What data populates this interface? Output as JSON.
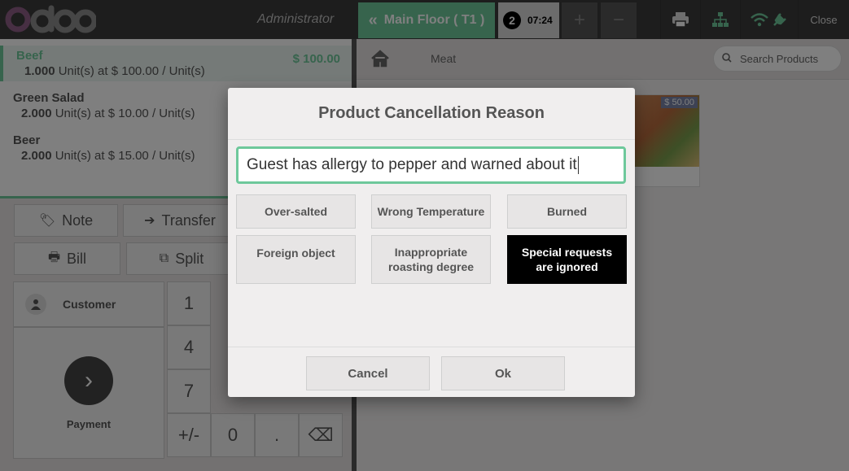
{
  "header": {
    "cashier": "Administrator",
    "floor_button": "Main Floor ( T1 )",
    "order_tab": {
      "guests": "2",
      "time": "07:24"
    },
    "plus_label": "+",
    "minus_label": "−",
    "close_label": "Close"
  },
  "orderlines": [
    {
      "name": "Beef",
      "price": "$ 100.00",
      "qty": "1.000",
      "info": "Unit(s) at $ 100.00 / Unit(s)"
    },
    {
      "name": "Green Salad",
      "price": "",
      "qty": "2.000",
      "info": "Unit(s) at $ 10.00 / Unit(s)"
    },
    {
      "name": "Beer",
      "price": "",
      "qty": "2.000",
      "info": "Unit(s) at $ 15.00 / Unit(s)"
    }
  ],
  "controls": {
    "note": "Note",
    "transfer": "Transfer",
    "bill": "Bill",
    "split": "Split",
    "customer": "Customer",
    "payment": "Payment"
  },
  "numpad": {
    "k1": "1",
    "k4": "4",
    "k7": "7",
    "plusminus": "+/-",
    "k0": "0",
    "dot": ".",
    "backspace": "⌫"
  },
  "products": {
    "breadcrumb": "Meat",
    "search_placeholder": "Search Products",
    "item_price": "$ 50.00"
  },
  "modal": {
    "title": "Product Cancellation Reason",
    "input_value": "Guest has allergy to pepper and warned about it",
    "reasons": [
      "Over-salted",
      "Wrong Temperature",
      "Burned",
      "Foreign object",
      "Inappropriate roasting degree",
      "Special requests are ignored"
    ],
    "cancel": "Cancel",
    "ok": "Ok"
  },
  "colors": {
    "accent": "#6ec89b",
    "header_bg": "#3a3a3a",
    "selected_reason": "#000000"
  }
}
